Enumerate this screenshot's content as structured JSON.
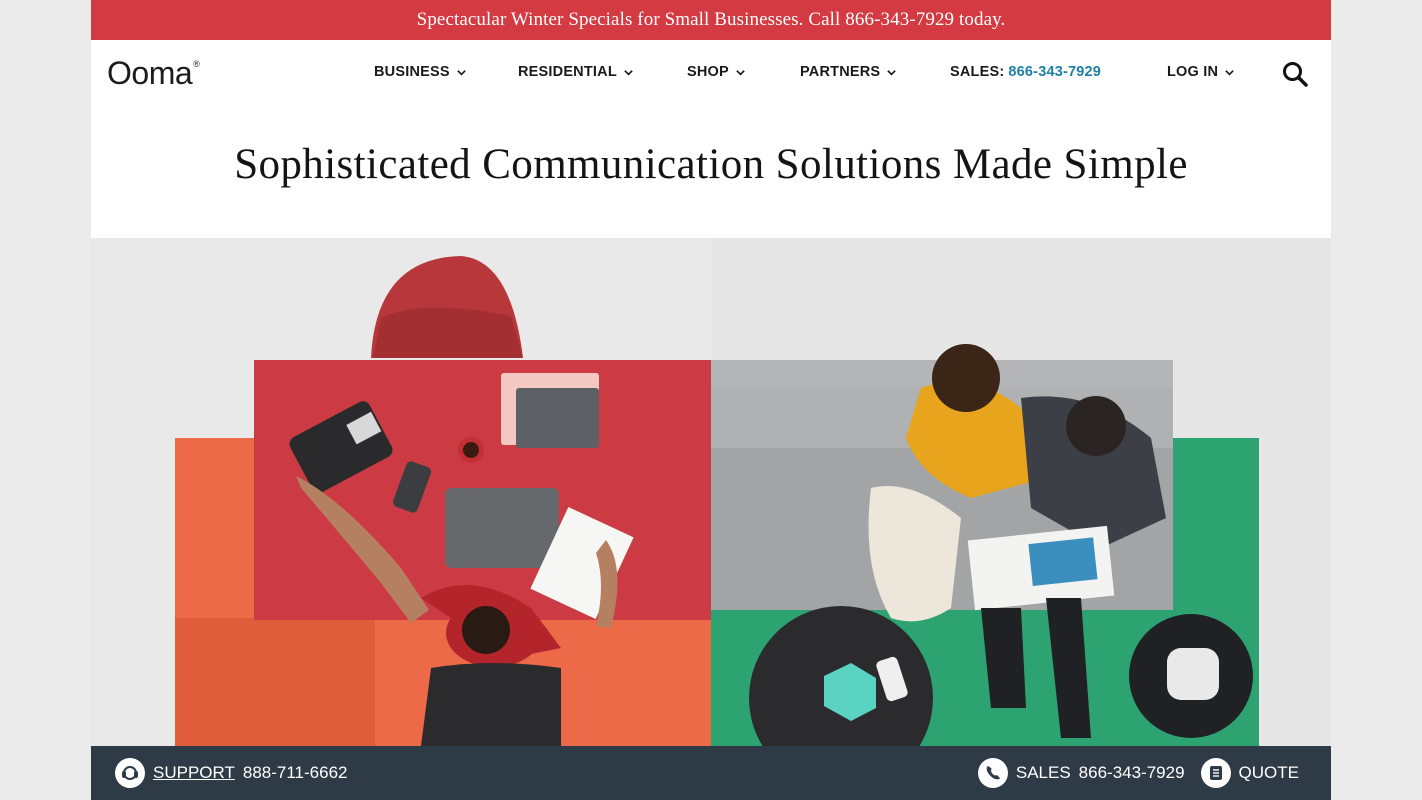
{
  "promo": {
    "text": "Spectacular Winter Specials for Small Businesses. Call 866-343-7929 today."
  },
  "header": {
    "logo": "Ooma",
    "logo_mark": "®",
    "nav": [
      {
        "label": "BUSINESS"
      },
      {
        "label": "RESIDENTIAL"
      },
      {
        "label": "SHOP"
      },
      {
        "label": "PARTNERS"
      }
    ],
    "sales_label": "SALES:",
    "sales_phone": "866-343-7929",
    "login_label": "LOG IN",
    "search_icon": "search-icon"
  },
  "hero": {
    "title": "Sophisticated Communication Solutions Made Simple",
    "image_icon": "hero-photo"
  },
  "footer_bar": {
    "support_label": "SUPPORT",
    "support_phone": "888-711-6662",
    "sales_label": "SALES",
    "sales_phone": "866-343-7929",
    "quote_label": "QUOTE"
  },
  "colors": {
    "promo_bg": "#d43a41",
    "accent_link": "#1f7fa6",
    "bottom_bar": "#2e3a46"
  }
}
